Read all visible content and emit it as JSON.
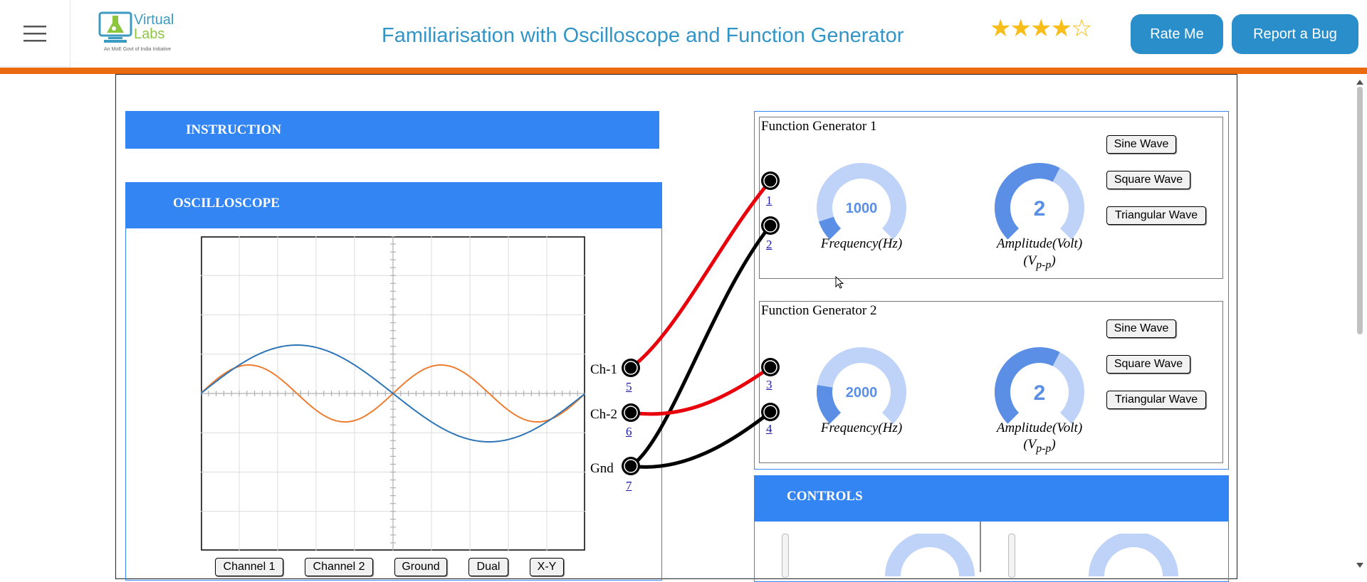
{
  "header": {
    "title": "Familiarisation with Oscilloscope and Function Generator",
    "logo_line1": "Virtual",
    "logo_line2": "Labs",
    "logo_tagline": "An MoE Govt of India Initiative",
    "rating": 4,
    "rating_max": 5,
    "rate_label": "Rate Me",
    "bug_label": "Report a Bug"
  },
  "instruction": {
    "label": "INSTRUCTION"
  },
  "oscilloscope": {
    "label": "OSCILLOSCOPE",
    "buttons": [
      "Channel 1",
      "Channel 2",
      "Ground",
      "Dual",
      "X-Y"
    ],
    "terminals": [
      {
        "label": "Ch-1",
        "num": "5"
      },
      {
        "label": "Ch-2",
        "num": "6"
      },
      {
        "label": "Gnd",
        "num": "7"
      }
    ],
    "trace_colors": {
      "ch1": "#2e75b6",
      "ch2": "#ed7d31"
    }
  },
  "function_generators": [
    {
      "title": "Function Generator 1",
      "terminals": [
        "1",
        "2"
      ],
      "frequency": "1000",
      "frequency_fraction": 0.1,
      "frequency_label": "Frequency(Hz)",
      "amplitude": "2",
      "amplitude_fraction": 0.6,
      "amplitude_label": "Amplitude(Volt)",
      "amplitude_unit": "(V",
      "amplitude_sub": "p-p",
      "amplitude_close": ")",
      "buttons": [
        "Sine Wave",
        "Square Wave",
        "Triangular Wave"
      ]
    },
    {
      "title": "Function Generator 2",
      "terminals": [
        "3",
        "4"
      ],
      "frequency": "2000",
      "frequency_fraction": 0.2,
      "frequency_label": "Frequency(Hz)",
      "amplitude": "2",
      "amplitude_fraction": 0.6,
      "amplitude_label": "Amplitude(Volt)",
      "amplitude_unit": "(V",
      "amplitude_sub": "p-p",
      "amplitude_close": ")",
      "buttons": [
        "Sine Wave",
        "Square Wave",
        "Triangular Wave"
      ]
    }
  ],
  "controls": {
    "label": "CONTROLS"
  },
  "colors": {
    "accent": "#3385f4",
    "wire_red": "#e8000b",
    "wire_black": "#000000",
    "header_orange": "#ea6a10"
  }
}
